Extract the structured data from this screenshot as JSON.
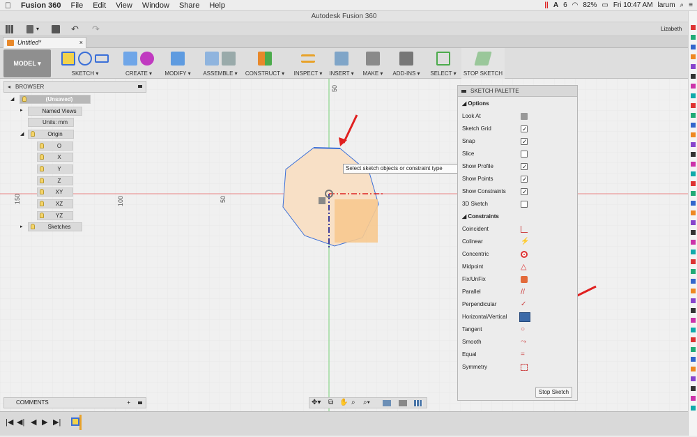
{
  "menubar": {
    "app_name": "Fusion 360",
    "items": [
      "File",
      "Edit",
      "View",
      "Window",
      "Share",
      "Help"
    ],
    "badge_count": "6",
    "battery": "82%",
    "clock": "Fri 10:47 AM",
    "user": "larum"
  },
  "window": {
    "title": "Autodesk Fusion 360",
    "user_name": "Lizabeth"
  },
  "doc_tab": {
    "label": "Untitled*"
  },
  "toolbar": {
    "workspace": "MODEL ▾",
    "groups": [
      {
        "label": "SKETCH ▾"
      },
      {
        "label": "CREATE ▾"
      },
      {
        "label": "MODIFY ▾"
      },
      {
        "label": "ASSEMBLE ▾"
      },
      {
        "label": "CONSTRUCT ▾"
      },
      {
        "label": "INSPECT ▾"
      },
      {
        "label": "INSERT ▾"
      },
      {
        "label": "MAKE ▾"
      },
      {
        "label": "ADD-INS ▾"
      },
      {
        "label": "SELECT ▾"
      },
      {
        "label": "STOP SKETCH"
      }
    ]
  },
  "browser": {
    "title": "BROWSER",
    "root": "(Unsaved)",
    "items": {
      "named_views": "Named Views",
      "units": "Units: mm",
      "origin": "Origin",
      "o": "O",
      "x": "X",
      "y": "Y",
      "z": "Z",
      "xy": "XY",
      "xz": "XZ",
      "yz": "YZ",
      "sketches": "Sketches"
    }
  },
  "comments": {
    "label": "COMMENTS"
  },
  "canvas": {
    "ruler_labels": {
      "top": "50",
      "left1": "150",
      "left2": "100",
      "left3": "50"
    },
    "tooltip": "Select sketch objects or constraint type"
  },
  "palette": {
    "title": "SKETCH PALETTE",
    "options_header": "Options",
    "options": [
      {
        "label": "Look At",
        "control": "icon",
        "checked": false
      },
      {
        "label": "Sketch Grid",
        "control": "checkbox",
        "checked": true
      },
      {
        "label": "Snap",
        "control": "checkbox",
        "checked": true
      },
      {
        "label": "Slice",
        "control": "checkbox",
        "checked": false
      },
      {
        "label": "Show Profile",
        "control": "checkbox",
        "checked": true
      },
      {
        "label": "Show Points",
        "control": "checkbox",
        "checked": true
      },
      {
        "label": "Show Constraints",
        "control": "checkbox",
        "checked": true
      },
      {
        "label": "3D Sketch",
        "control": "checkbox",
        "checked": false
      }
    ],
    "constraints_header": "Constraints",
    "constraints": [
      {
        "label": "Coincident",
        "icon": "coincident-icon"
      },
      {
        "label": "Colinear",
        "icon": "colinear-icon"
      },
      {
        "label": "Concentric",
        "icon": "concentric-icon"
      },
      {
        "label": "Midpoint",
        "icon": "midpoint-icon"
      },
      {
        "label": "Fix/UnFix",
        "icon": "lock-icon"
      },
      {
        "label": "Parallel",
        "icon": "parallel-icon"
      },
      {
        "label": "Perpendicular",
        "icon": "perpendicular-icon"
      },
      {
        "label": "Horizontal/Vertical",
        "icon": "horizontal-vertical-icon"
      },
      {
        "label": "Tangent",
        "icon": "tangent-icon"
      },
      {
        "label": "Smooth",
        "icon": "smooth-icon"
      },
      {
        "label": "Equal",
        "icon": "equal-icon"
      },
      {
        "label": "Symmetry",
        "icon": "symmetry-icon"
      }
    ],
    "stop_button": "Stop Sketch"
  },
  "colors": {
    "accent_red": "#e02020",
    "axis_green": "#3cc43c",
    "sketch_blue": "#3a6fd8",
    "profile_fill": "#f7d9b5"
  }
}
